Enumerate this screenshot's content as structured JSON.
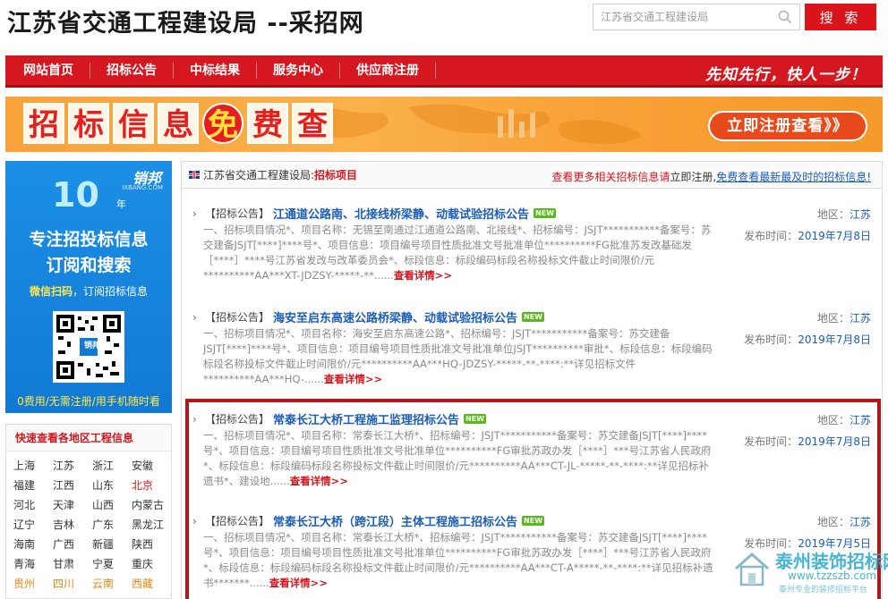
{
  "header": {
    "site_title": "江苏省交通工程建设局 --采招网",
    "search_placeholder": "江苏省交通工程建设局",
    "search_button": "搜 索"
  },
  "nav": {
    "items": [
      "网站首页",
      "招标公告",
      "中标结果",
      "服务中心",
      "供应商注册"
    ],
    "slogan": "先知先行，快人一步！"
  },
  "banner": {
    "title_chars": [
      "招",
      "标",
      "信",
      "息",
      "免",
      "费",
      "查"
    ],
    "cta": "立即注册查看》》"
  },
  "side_ad": {
    "logo": "销邦",
    "logo_sub": "IXBANG.COM",
    "anniv": "10",
    "anniv_sub": "年",
    "line1": "专注招投标信息",
    "line2": "订阅和搜索",
    "scan_hl": "微信扫码",
    "scan_rest": "，订阅招标信息",
    "qr_label": "销邦",
    "footer": "0费用/无需注册/用手机随时看"
  },
  "regions": {
    "title": "快速查看各地区工程信息",
    "items": [
      {
        "name": "上海",
        "style": ""
      },
      {
        "name": "江苏",
        "style": ""
      },
      {
        "name": "浙江",
        "style": ""
      },
      {
        "name": "安徽",
        "style": ""
      },
      {
        "name": "福建",
        "style": ""
      },
      {
        "name": "江西",
        "style": ""
      },
      {
        "name": "山东",
        "style": ""
      },
      {
        "name": "北京",
        "style": "hot"
      },
      {
        "name": "河北",
        "style": ""
      },
      {
        "name": "天津",
        "style": ""
      },
      {
        "name": "山西",
        "style": ""
      },
      {
        "name": "内蒙古",
        "style": ""
      },
      {
        "name": "辽宁",
        "style": ""
      },
      {
        "name": "吉林",
        "style": ""
      },
      {
        "name": "广东",
        "style": ""
      },
      {
        "name": "黑龙江",
        "style": ""
      },
      {
        "name": "海南",
        "style": ""
      },
      {
        "name": "广西",
        "style": ""
      },
      {
        "name": "新疆",
        "style": ""
      },
      {
        "name": "陕西",
        "style": ""
      },
      {
        "name": "青海",
        "style": ""
      },
      {
        "name": "甘肃",
        "style": ""
      },
      {
        "name": "宁夏",
        "style": ""
      },
      {
        "name": "重庆",
        "style": ""
      },
      {
        "name": "贵州",
        "style": "warm"
      },
      {
        "name": "四川",
        "style": "warm"
      },
      {
        "name": "云南",
        "style": "warm"
      },
      {
        "name": "西藏",
        "style": "warm"
      }
    ]
  },
  "list": {
    "breadcrumb_site": "江苏省交通工程建设局:",
    "breadcrumb_current": "招标项目",
    "head_right_red": "查看更多相关招标信息请",
    "head_right_dark": "立即注册,",
    "head_right_link": "免费查看最新最及时的招标信息!",
    "region_label": "地区：",
    "date_label": "发布时间：",
    "more_label": "查看详情>>",
    "new_badge": "NEW",
    "items": [
      {
        "tag": "【招标公告】",
        "title": "江通道公路南、北接线桥梁静、动载试验招标公告",
        "region": "江苏",
        "date": "2019年7月8日",
        "desc": "一、招标项目情况*、项目名称：无锡至南通过江通道公路南、北接线*、招标编号：JSJT***********备案号：苏交建备JSJT[****]****号*、项目信息：项目编号项目性质批准文号批准单位**********FG批准苏发改基础发［****］****号江苏省发改与改革委员会*、标段信息：标段编码标段名称投标文件截止时间限价/元**********AA***XT-JDZSY-*****-**......"
      },
      {
        "tag": "【招标公告】",
        "title": "海安至启东高速公路桥梁静、动载试验招标公告",
        "region": "江苏",
        "date": "2019年7月8日",
        "desc": "一、招标项目情况*、项目名称：海安至启东高速公路*、招标编号：JSJT***********备案号：苏交建备JSJT[****]****号*、项目信息：项目编号项目性质批准文号批准单位JSJT**********审批*、标段信息：标段编码标段名称投标文件截止时间限价/元**********AA***HQ-JDZSY-*****-**-****:**详见招标文件**********AA***HQ-......"
      },
      {
        "tag": "【招标公告】",
        "title": "常泰长江大桥工程施工监理招标公告",
        "region": "江苏",
        "date": "2019年7月8日",
        "desc": "一、招标项目情况*、项目名称：常泰长江大桥*、招标编号：JSJT***********备案号：苏交建备JSJT[****]****号*、项目信息：项目编号项目性质批准文号批准单位**********FG审批苏政办发［****］***号江苏省人民政府*、标段信息：标段编码标段名称投标文件截止时间限价/元**********AA***CT-JL-*****-**-****:**详见招标补遗书*、建设地......"
      },
      {
        "tag": "【招标公告】",
        "title": "常泰长江大桥（跨江段）主体工程施工招标公告",
        "region": "江苏",
        "date": "2019年7月5日",
        "desc": "一、招标项目情况*、项目名称：常泰长江大桥*、招标编号：JSJT***********备案号：苏交建备JSJT[****]****号*、项目信息：项目编号项目性质批准文号批准单位**********FG审批苏政办发［****］***号江苏省人民政府*、标段信息：标段编码标段名称投标文件截止时间限价/元**********AA***CT-A*****-**-****:**详见招标补遗书*******......"
      }
    ]
  },
  "watermark": {
    "name": "泰州装饰招标网",
    "url": "www.tzzszb.com",
    "slogan": "泰州专业的装修招标平台"
  },
  "colors": {
    "brand_red": "#d5161e",
    "link_blue": "#1b5db8",
    "banner_orange": "#f9a23a",
    "side_blue": "#1179d4"
  }
}
